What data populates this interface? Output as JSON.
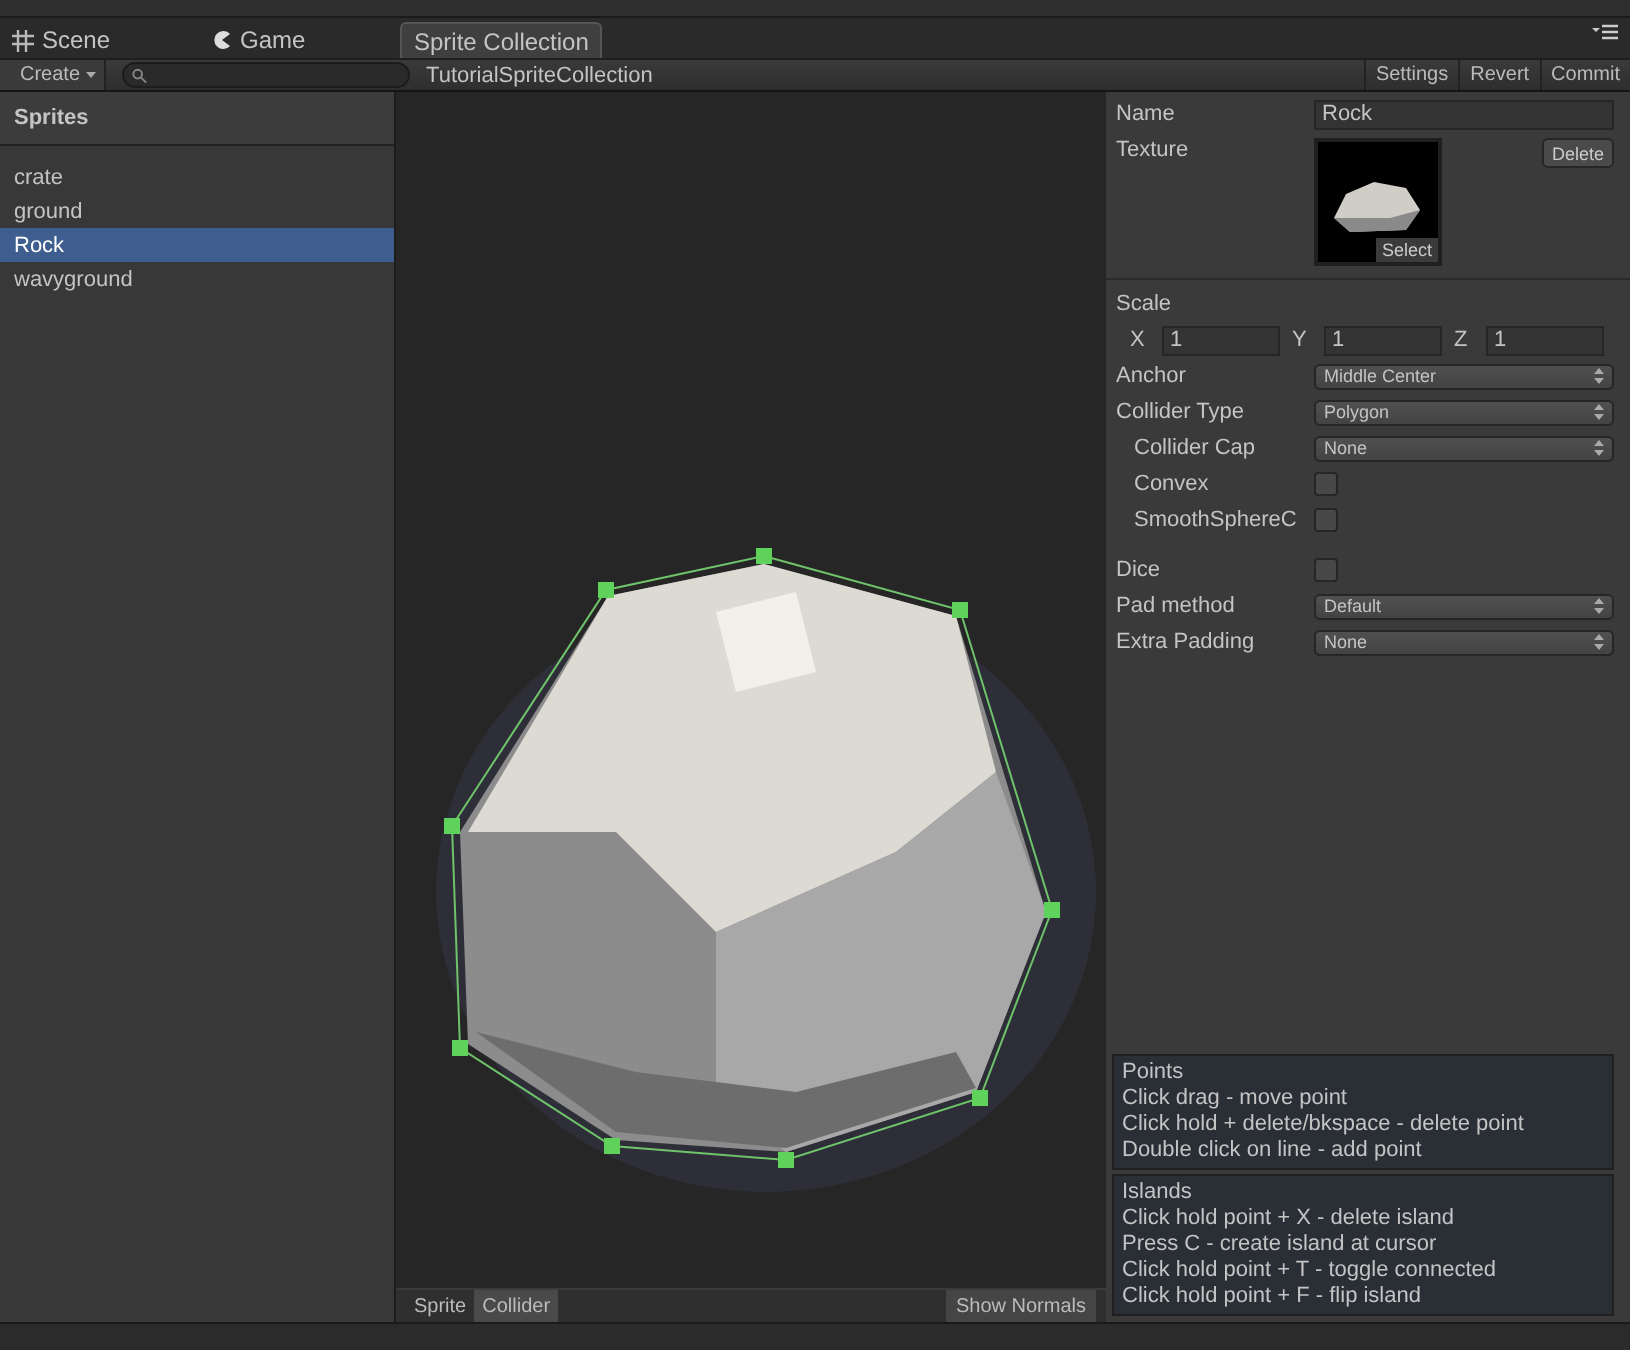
{
  "top_tabs": [
    {
      "label": "Scene",
      "kind": "scene",
      "selected": false
    },
    {
      "label": "Game",
      "kind": "game",
      "selected": false
    },
    {
      "label": "Sprite Collection",
      "kind": "editor",
      "selected": true
    }
  ],
  "toolbar": {
    "create_button": "Create",
    "collection_name": "TutorialSpriteCollection",
    "buttons": [
      "Settings",
      "Revert",
      "Commit"
    ]
  },
  "sidebar": {
    "title": "Sprites",
    "items": [
      {
        "label": "crate",
        "selected": false
      },
      {
        "label": "ground",
        "selected": false
      },
      {
        "label": "Rock",
        "selected": true
      },
      {
        "label": "wavyground",
        "selected": false
      }
    ]
  },
  "canvas": {
    "view_tabs": [
      {
        "label": "Sprite",
        "selected": false
      },
      {
        "label": "Collider",
        "selected": true
      }
    ],
    "show_normals_button": "Show Normals"
  },
  "inspector": {
    "name_label": "Name",
    "name_value": "Rock",
    "texture_label": "Texture",
    "delete_button": "Delete",
    "select_button": "Select",
    "scale_label": "Scale",
    "scale": [
      {
        "axis": "X",
        "value": "1"
      },
      {
        "axis": "Y",
        "value": "1"
      },
      {
        "axis": "Z",
        "value": "1"
      }
    ],
    "rows": [
      {
        "kind": "dropdown",
        "label": "Anchor",
        "value": "Middle Center"
      },
      {
        "kind": "dropdown",
        "label": "Collider Type",
        "value": "Polygon",
        "children": [
          {
            "kind": "dropdown",
            "label": "Collider Cap",
            "value": "None"
          },
          {
            "kind": "checkbox",
            "label": "Convex",
            "checked": false
          },
          {
            "kind": "checkbox",
            "label": "SmoothSphereC",
            "checked": false
          }
        ]
      },
      {
        "kind": "checkbox",
        "label": "Dice",
        "checked": false
      },
      {
        "kind": "dropdown",
        "label": "Pad method",
        "value": "Default"
      },
      {
        "kind": "dropdown",
        "label": "Extra Padding",
        "value": "None"
      }
    ],
    "help": [
      {
        "title": "Points",
        "lines": [
          "Click drag - move point",
          "Click hold + delete/bkspace - delete point",
          "Double click on line - add point"
        ]
      },
      {
        "title": "Islands",
        "lines": [
          "Click hold point + X - delete island",
          "Press C - create island at cursor",
          "Click hold point + T - toggle connected",
          "Click hold point + F - flip island"
        ]
      }
    ]
  }
}
